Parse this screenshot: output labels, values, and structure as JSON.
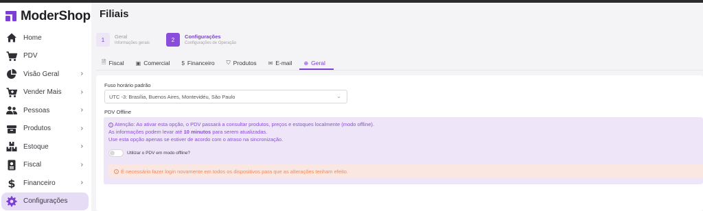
{
  "app": {
    "name": "ModerShop"
  },
  "sidebar": {
    "items": [
      {
        "label": "Home",
        "icon": "home-icon",
        "chevron": false,
        "active": false
      },
      {
        "label": "PDV",
        "icon": "cart-icon",
        "chevron": false,
        "active": false
      },
      {
        "label": "Visão Geral",
        "icon": "pie-chart-icon",
        "chevron": true,
        "active": false
      },
      {
        "label": "Vender Mais",
        "icon": "cart-plus-icon",
        "chevron": true,
        "active": false
      },
      {
        "label": "Pessoas",
        "icon": "users-icon",
        "chevron": true,
        "active": false
      },
      {
        "label": "Produtos",
        "icon": "box-icon",
        "chevron": true,
        "active": false
      },
      {
        "label": "Estoque",
        "icon": "boxes-icon",
        "chevron": true,
        "active": false
      },
      {
        "label": "Fiscal",
        "icon": "id-badge-icon",
        "chevron": true,
        "active": false
      },
      {
        "label": "Financeiro",
        "icon": "dollar-icon",
        "chevron": true,
        "active": false
      },
      {
        "label": "Configurações",
        "icon": "gear-icon",
        "chevron": false,
        "active": true
      }
    ],
    "chevron_glyph": "›"
  },
  "page": {
    "title": "Filiais"
  },
  "steps": [
    {
      "num": "1",
      "title": "Geral",
      "subtitle": "Informações gerais",
      "active": false
    },
    {
      "num": "2",
      "title": "Configurações",
      "subtitle": "Configurações de Operação",
      "active": true
    }
  ],
  "tabs": [
    {
      "label": "Fiscal",
      "icon": "document-icon",
      "glyph": "🗎",
      "active": false
    },
    {
      "label": "Comercial",
      "icon": "calendar-icon",
      "glyph": "▣",
      "active": false
    },
    {
      "label": "Financeiro",
      "icon": "dollar-icon",
      "glyph": "$",
      "active": false
    },
    {
      "label": "Produtos",
      "icon": "tag-icon",
      "glyph": "⛉",
      "active": false
    },
    {
      "label": "E-mail",
      "icon": "mail-icon",
      "glyph": "✉",
      "active": false
    },
    {
      "label": "Geral",
      "icon": "globe-icon",
      "glyph": "⊕",
      "active": true
    }
  ],
  "form": {
    "timezone": {
      "label": "Fuso horário padrão",
      "value": "UTC -3: Brasília, Buenos Aires, Montevidéu, São Paulo"
    },
    "pdv_offline": {
      "label": "PDV Offline",
      "warning_line1": "Atenção: Ao ativar esta opção, o PDV passará a consultar produtos, preços e estoques localmente (modo offline).",
      "warning_line2_pre": "As informações podem levar até ",
      "warning_line2_bold": "10 minutos",
      "warning_line2_post": " para serem atualizadas.",
      "warning_line3": "Use esta opção apenas se estiver de acordo com o atraso na sincronização.",
      "toggle_label": "Utilizar o PDV em modo offline?",
      "toggle_on": false,
      "alert": "É necessário fazer login novamente em todos os dispositivos para que as alterações tenham efeito."
    }
  },
  "colors": {
    "accent": "#7b3fd3",
    "alert": "#f08a5d",
    "offline_bg": "#eee6f8"
  }
}
